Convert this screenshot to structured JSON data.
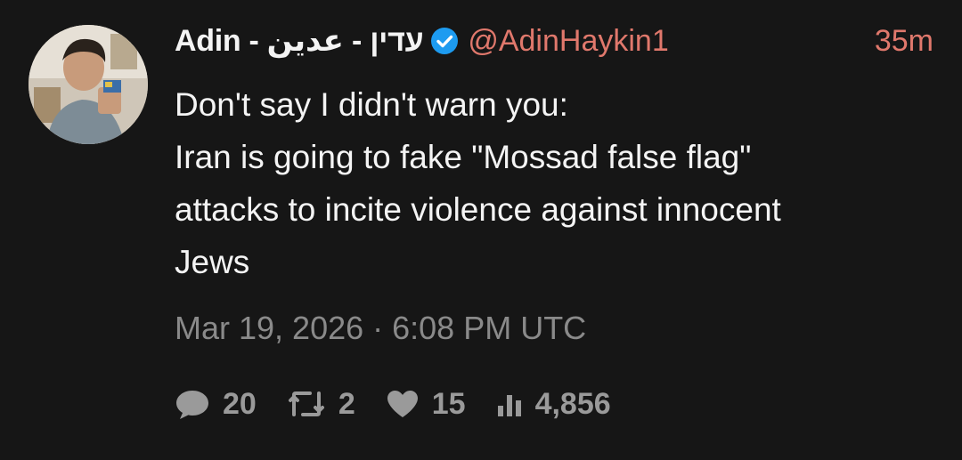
{
  "post": {
    "author": {
      "display_name": "Adin - עדין - عدين",
      "handle": "@AdinHaykin1",
      "verified": true,
      "avatar_icon": "profile-photo"
    },
    "relative_time": "35m",
    "text_lines": [
      "Don't say I didn't warn you:",
      "Iran is going to fake \"Mossad false flag\"",
      "attacks to incite violence against innocent",
      "Jews"
    ],
    "timestamp": "Mar 19, 2026 · 6:08 PM UTC",
    "stats": {
      "replies": "20",
      "retweets": "2",
      "likes": "15",
      "views": "4,856"
    }
  },
  "colors": {
    "background": "#161616",
    "accent": "#e0786c",
    "verified": "#1d9bf0",
    "muted": "#8a8a8a"
  }
}
